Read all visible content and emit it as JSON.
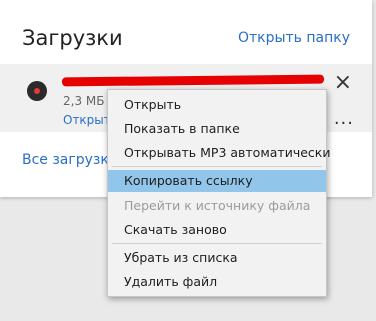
{
  "downloads_panel": {
    "title": "Загрузки",
    "open_folder": "Открыть папку",
    "all_downloads": "Все загрузки"
  },
  "download_item": {
    "size": "2,3 МБ",
    "open_label": "Открыт",
    "close_symbol": "×",
    "more_symbol": "···"
  },
  "context_menu": {
    "items": [
      {
        "label": "Открыть"
      },
      {
        "label": "Показать в папке"
      },
      {
        "label": "Открывать MP3 автоматически"
      },
      {
        "label": "Копировать ссылку"
      },
      {
        "label": "Перейти к источнику файла"
      },
      {
        "label": "Скачать заново"
      },
      {
        "label": "Убрать из списка"
      },
      {
        "label": "Удалить файл"
      }
    ]
  },
  "colors": {
    "link": "#2a6fc7",
    "highlight": "#91c6ea",
    "redaction": "#e60000"
  }
}
